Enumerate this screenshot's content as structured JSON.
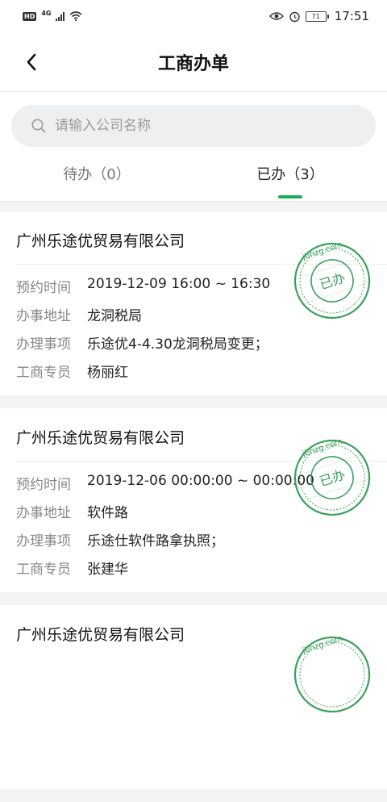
{
  "status_bar": {
    "hd": "HD",
    "network": "4G",
    "battery": "71",
    "time": "17:51"
  },
  "header": {
    "title": "工商办单"
  },
  "search": {
    "placeholder": "请输入公司名称"
  },
  "tabs": [
    {
      "label": "待办（0）",
      "active": false
    },
    {
      "label": "已办（3）",
      "active": true
    }
  ],
  "field_labels": {
    "time": "预约时间",
    "address": "办事地址",
    "item": "办理事项",
    "agent": "工商专员"
  },
  "stamp": {
    "site": "jbhzg.com",
    "text": "已办",
    "color": "#3aa05a"
  },
  "accent_color": "#1aad5a",
  "cards": [
    {
      "company": "广州乐途优贸易有限公司",
      "time": "2019-12-09  16:00 ~ 16:30",
      "address": "龙洞税局",
      "item": "乐途优4-4.30龙洞税局变更；",
      "agent": "杨丽红"
    },
    {
      "company": "广州乐途优贸易有限公司",
      "time": "2019-12-06  00:00:00 ~ 00:00:00",
      "address": "软件路",
      "item": "乐途仕软件路拿执照；",
      "agent": "张建华"
    },
    {
      "company": "广州乐途优贸易有限公司"
    }
  ]
}
